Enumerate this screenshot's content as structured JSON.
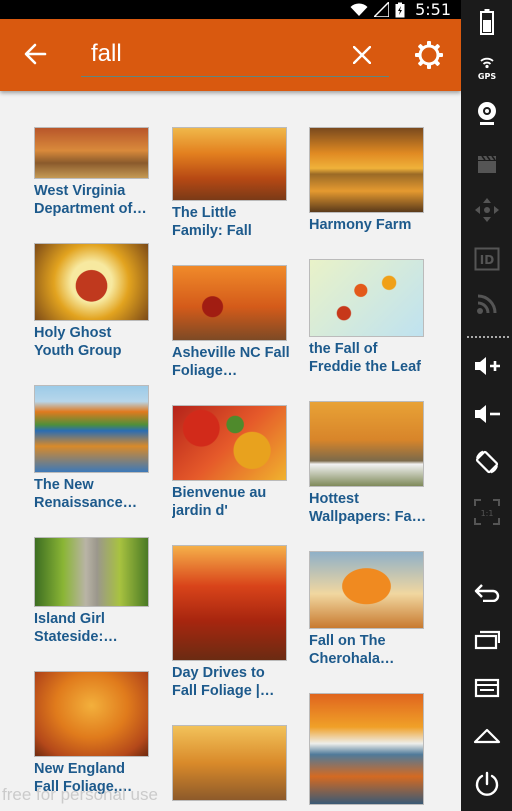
{
  "status_bar": {
    "time": "5:51"
  },
  "toolbar": {
    "search_value": "fall",
    "colors": {
      "toolbar": "#d9590f",
      "caption": "#1d5a8c"
    }
  },
  "results": {
    "columns": [
      [
        {
          "caption": "West Virginia Department of…",
          "thumb": "autumn-forest-path"
        },
        {
          "caption": "Holy Ghost Youth Group",
          "thumb": "maple-leaf-sky"
        },
        {
          "caption": "The New Renaissance…",
          "thumb": "lake-reflection"
        },
        {
          "caption": "Island Girl Stateside:…",
          "thumb": "tree-lined-road"
        },
        {
          "caption": "New England Fall Foliage,…",
          "thumb": "orange-tree-canopy"
        }
      ],
      [
        {
          "caption": "The Little Family: Fall",
          "thumb": "sunlit-orange-woods"
        },
        {
          "caption": "Asheville NC Fall Foliage…",
          "thumb": "train-in-forest"
        },
        {
          "caption": "Bienvenue au jardin d'",
          "thumb": "red-leaves-closeup"
        },
        {
          "caption": "Day Drives to Fall Foliage |…",
          "thumb": "red-forest-path"
        },
        {
          "caption": "",
          "thumb": "autumn-park-trees"
        }
      ],
      [
        {
          "caption": "Harmony Farm",
          "thumb": "golden-lake-reflection"
        },
        {
          "caption": "the Fall of Freddie the Leaf",
          "thumb": "falling-leaves"
        },
        {
          "caption": "Hottest Wallpapers: Fa…",
          "thumb": "road-white-fence"
        },
        {
          "caption": "Fall on The Cherohala…",
          "thumb": "lone-orange-tree"
        },
        {
          "caption": "",
          "thumb": "lakeside-houses"
        }
      ]
    ]
  },
  "watermark": "free for personal use",
  "emulator_toolbar": {
    "gps_label": "GPS",
    "id_label": "ID",
    "scale_label": "1:1"
  }
}
